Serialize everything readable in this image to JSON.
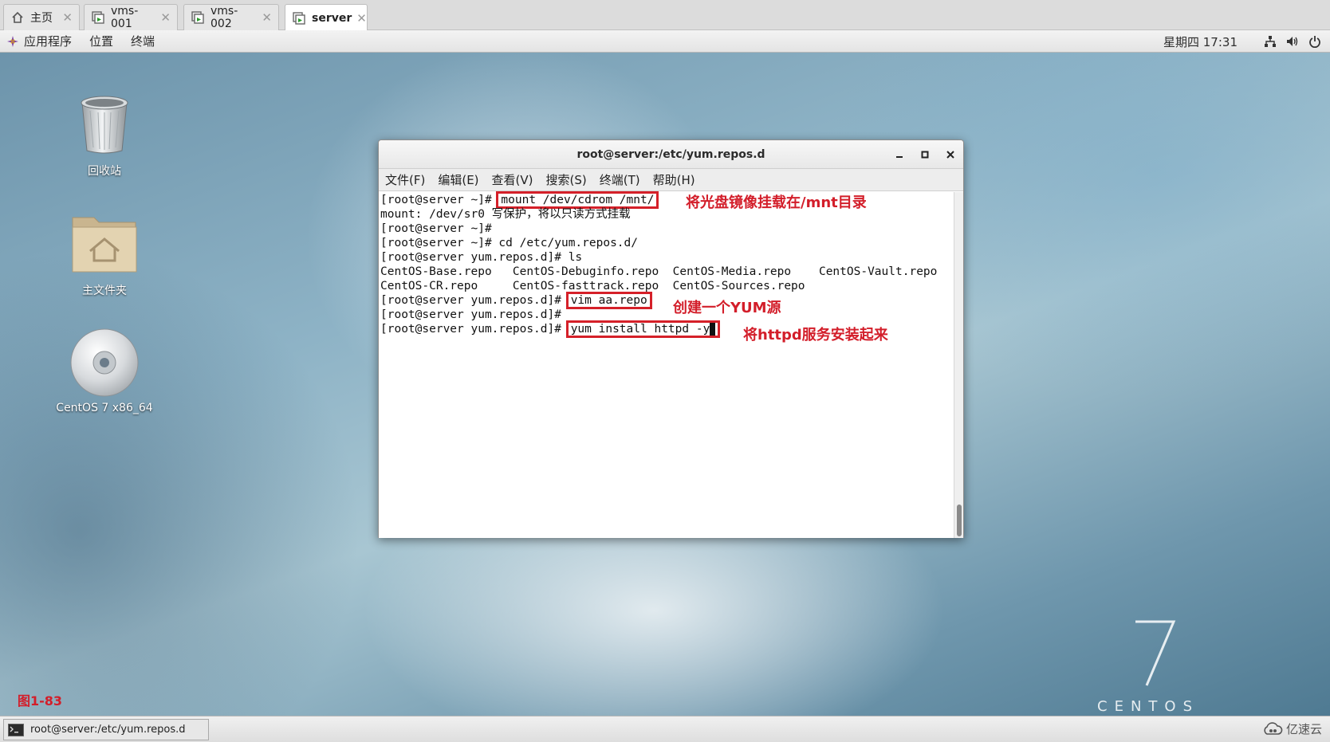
{
  "vm_tabs": [
    {
      "label": "主页",
      "icon": "home-icon"
    },
    {
      "label": "vms-001",
      "icon": "vm-icon"
    },
    {
      "label": "vms-002",
      "icon": "vm-icon"
    },
    {
      "label": "server",
      "icon": "vm-icon",
      "active": true
    }
  ],
  "tab_close_glyph": "✕",
  "top_panel": {
    "menus": [
      "应用程序",
      "位置",
      "终端"
    ],
    "clock": "星期四 17:31",
    "icons": [
      "network-icon",
      "volume-icon",
      "power-icon"
    ]
  },
  "desktop_icons": [
    {
      "label": "回收站",
      "icon": "trash-icon"
    },
    {
      "label": "主文件夹",
      "icon": "home-folder-icon"
    },
    {
      "label": "CentOS 7 x86_64",
      "icon": "disc-icon"
    }
  ],
  "centos_logo": {
    "number": "7",
    "word": "CENTOS"
  },
  "figure_label": "图1-83",
  "terminal": {
    "title": "root@server:/etc/yum.repos.d",
    "window_buttons": [
      "minimize-icon",
      "maximize-icon",
      "close-icon"
    ],
    "menus": [
      "文件(F)",
      "编辑(E)",
      "查看(V)",
      "搜索(S)",
      "终端(T)",
      "帮助(H)"
    ],
    "lines": {
      "l1_prompt": "[root@server ~]# ",
      "l1_cmd": "mount /dev/cdrom /mnt/",
      "l2": "mount: /dev/sr0 写保护，将以只读方式挂载",
      "l3": "[root@server ~]#",
      "l4": "[root@server ~]# cd /etc/yum.repos.d/",
      "l5": "[root@server yum.repos.d]# ls",
      "l6": "CentOS-Base.repo   CentOS-Debuginfo.repo  CentOS-Media.repo    CentOS-Vault.repo",
      "l7": "CentOS-CR.repo     CentOS-fasttrack.repo  CentOS-Sources.repo",
      "l8_prompt": "[root@server yum.repos.d]# ",
      "l8_cmd": "vim aa.repo",
      "l9": "[root@server yum.repos.d]#",
      "l10_prompt": "[root@server yum.repos.d]# ",
      "l10_cmd": "yum install httpd -y"
    }
  },
  "annotations": {
    "a1": "将光盘镜像挂载在/mnt目录",
    "a2": "创建一个YUM源",
    "a3": "将httpd服务安装起来"
  },
  "taskbar": {
    "item_label": "root@server:/etc/yum.repos.d"
  },
  "watermark": "亿速云",
  "colors": {
    "annotation_red": "#d31e2a",
    "terminal_bg": "#ffffff",
    "panel_bg": "#ececec"
  }
}
